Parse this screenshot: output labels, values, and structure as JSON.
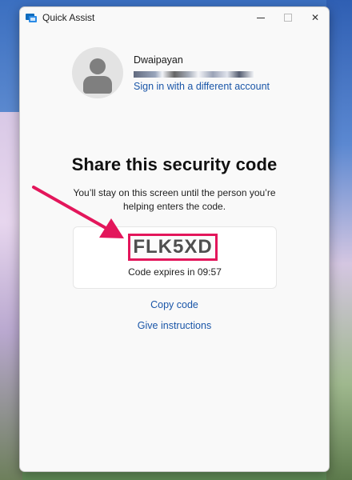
{
  "window": {
    "title": "Quick Assist",
    "app_icon": "quick-assist-icon"
  },
  "titlebar": {
    "minimize_icon": "minimize-icon",
    "maximize_icon": "maximize-icon",
    "close_icon": "close-icon",
    "close_glyph": "✕"
  },
  "account": {
    "name": "Dwaipayan",
    "switch_label": "Sign in with a different account",
    "avatar_icon": "user-avatar-icon"
  },
  "main": {
    "heading": "Share this security code",
    "subtext": "You’ll stay on this screen until the person you’re helping enters the code.",
    "code": "FLK5XD",
    "expiry": "Code expires in 09:57",
    "copy_label": "Copy code",
    "instructions_label": "Give instructions"
  },
  "annotation": {
    "arrow_color": "#e3165b",
    "highlight_color": "#e3165b"
  },
  "colors": {
    "link": "#1a56a8",
    "window_bg": "#f9f9f9"
  }
}
